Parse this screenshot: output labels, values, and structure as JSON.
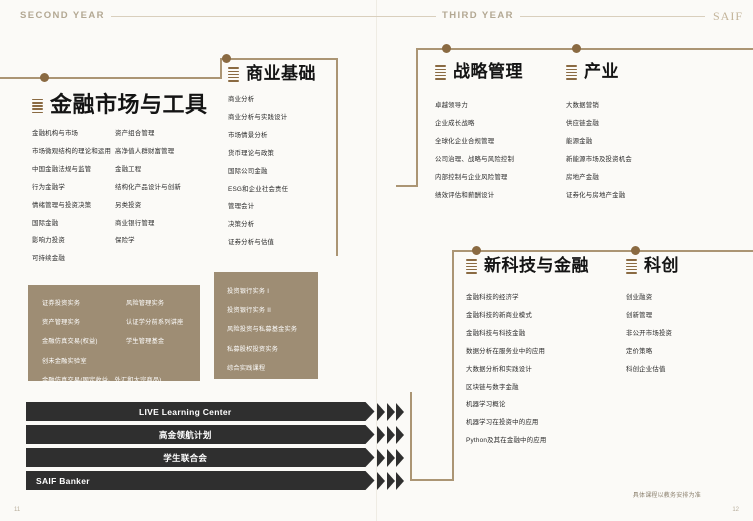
{
  "header": {
    "year_second": "SECOND YEAR",
    "year_third": "THIRD YEAR",
    "logo": "SAIF"
  },
  "sections": [
    {
      "id": "financial-markets",
      "title": "金融市场与工具",
      "col1": [
        "金融机构与市场",
        "市场微观结构的理论和运用",
        "中国金融法规与监管",
        "行为金融学",
        "情绪管理与投资决策",
        "国际金融",
        "影响力投资",
        "可持续金融"
      ],
      "col2": [
        "资产组合管理",
        "高净值人群财富管理",
        "金融工程",
        "结构化产品设计与创新",
        "另类投资",
        "商业银行管理",
        "保险学"
      ]
    },
    {
      "id": "business-foundation",
      "title": "商业基础",
      "col1": [
        "商业分析",
        "商业分析与实践设计",
        "市场情景分析",
        "货币理论与政策",
        "国际公司金融",
        "ESG和企业社会责任",
        "管理会计",
        "决策分析",
        "证券分析与估值"
      ]
    },
    {
      "id": "strategic-management",
      "title": "战略管理",
      "col1": [
        "卓越领导力",
        "企业成长战略",
        "全球化企业合规管理",
        "公司治理、战略与风险控制",
        "内部控制与企业风险管理",
        "绩效评估和薪酬设计"
      ]
    },
    {
      "id": "industry",
      "title": "产业",
      "col1": [
        "大数据营销",
        "供应链金融",
        "能源金融",
        "新能源市场及投资机会",
        "房地产金融",
        "证券化与房地产金融"
      ]
    },
    {
      "id": "fintech",
      "title": "新科技与金融",
      "col1": [
        "金融科技的经济学",
        "金融科技的新商业模式",
        "金融科技与科技金融",
        "数据分析在服务业中的应用",
        "大数据分析和实践设计",
        "区块链与数字金融",
        "机器学习概论",
        "机器学习在投资中的应用",
        "Python及其在金融中的应用"
      ]
    },
    {
      "id": "innovation",
      "title": "科创",
      "col1": [
        "创业融资",
        "创新管理",
        "非公开市场投资",
        "定价策略",
        "科创企业估值"
      ]
    }
  ],
  "practice_box_left": {
    "col1": [
      "证券投资实务",
      "资产管理实务",
      "金融仿真交易(权益)",
      "创未金融实验室",
      "金融仿真交易(固定收益、外汇和大宗商品)"
    ],
    "col2": [
      "风险管理实务",
      "认证学分前系列讲座",
      "学生管理基金"
    ]
  },
  "practice_box_right": {
    "col1": [
      "投资银行实务 I",
      "投资银行实务 II",
      "风险投资与私募基金实务",
      "私募股权投资实务",
      "综合实践课程"
    ]
  },
  "banners": [
    {
      "label": "LIVE Learning Center",
      "align": "center"
    },
    {
      "label": "高金领航计划",
      "align": "center"
    },
    {
      "label": "学生联合会",
      "align": "center"
    },
    {
      "label": "SAIF Banker",
      "align": "left"
    }
  ],
  "footer": {
    "note": "具体课程以教务安排为准",
    "page_left": "11",
    "page_right": "12"
  },
  "colors": {
    "accent_brown": "#8a6a42",
    "line_tan": "#ab9574",
    "beige_box": "#9e8d74",
    "banner_black": "#2f2f2f",
    "page_bg": "#fbfaf7"
  }
}
